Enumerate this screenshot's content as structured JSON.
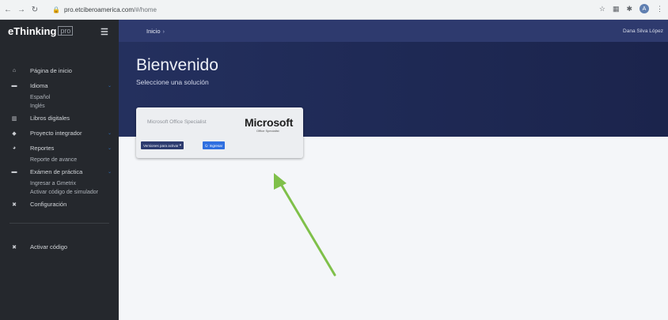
{
  "browser": {
    "url_host": "pro.etciberoamerica.com",
    "url_path": "/#/home",
    "ext_avatar_letter": "A"
  },
  "sidebar": {
    "brand": "eThinking",
    "brand_badge": "pro",
    "items": [
      {
        "label": "Página de inicio",
        "icon": "home-icon"
      },
      {
        "label": "Idioma",
        "icon": "keyboard-icon",
        "sub": [
          "Español",
          "Inglés"
        ]
      },
      {
        "label": "Libros digitales",
        "icon": "books-icon"
      },
      {
        "label": "Proyecto integrador",
        "icon": "puzzle-icon"
      },
      {
        "label": "Reportes",
        "icon": "chart-icon",
        "sub": [
          "Reporte de avance"
        ]
      },
      {
        "label": "Exámen de práctica",
        "icon": "keyboard-icon",
        "sub": [
          "Ingresar a Gmetrix",
          "Activar código de simulador"
        ]
      },
      {
        "label": "Configuración",
        "icon": "tools-icon"
      },
      {
        "label": "Activar código",
        "icon": "tools-icon"
      }
    ]
  },
  "topbar": {
    "breadcrumb": "Inicio",
    "user": "Dana Silva López"
  },
  "hero": {
    "title": "Bienvenido",
    "subtitle": "Seleccione una solución"
  },
  "card": {
    "name": "Microsoft Office Specialist",
    "logo": "Microsoft",
    "logo_sub": "Office Specialist",
    "versions_button": "Versiones para activar",
    "enter_button": "Ingresar"
  },
  "colors": {
    "sidebar": "#25282d",
    "header": "#2e3a6e",
    "accent": "#2f6fe0",
    "annotation_arrow": "#7fc04a"
  }
}
